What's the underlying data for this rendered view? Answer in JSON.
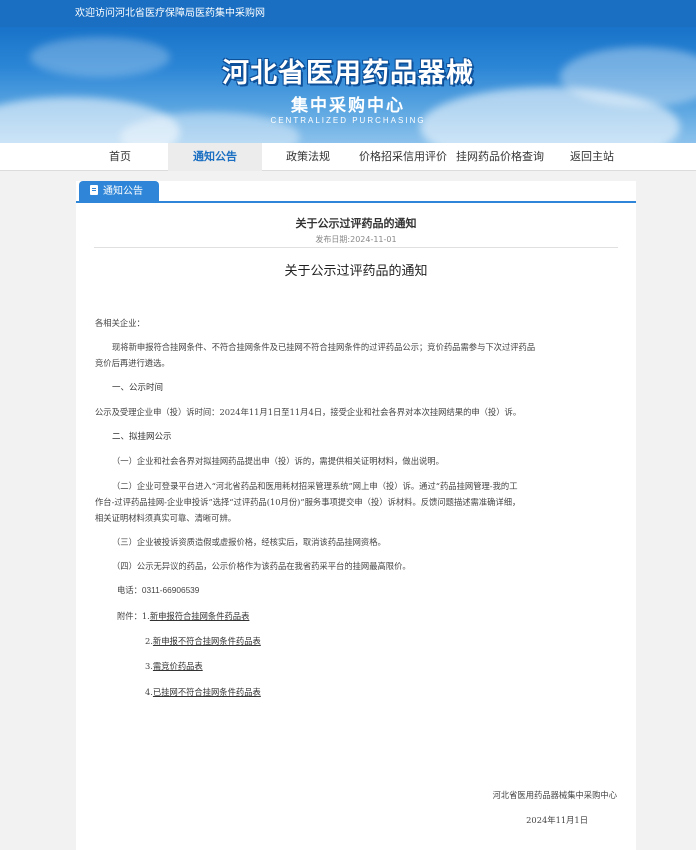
{
  "topbar": {
    "welcome": "欢迎访问河北省医疗保障局医药集中采购网"
  },
  "banner": {
    "title": "河北省医用药品器械",
    "subtitle": "集中采购中心",
    "english": "CENTRALIZED PURCHASING"
  },
  "nav": {
    "items": [
      "首页",
      "通知公告",
      "政策法规",
      "价格招采信用评价",
      "挂网药品价格查询",
      "返回主站"
    ],
    "active": "通知公告"
  },
  "section": {
    "tab_label": "通知公告"
  },
  "article": {
    "title": "关于公示过评药品的通知",
    "date": "发布日期:2024-11-01",
    "heading": "关于公示过评药品的通知",
    "greeting": "各相关企业：",
    "intro_1": "现将新申报符合挂网条件、不符合挂网条件及已挂网不符合挂网条件的过评药品公示；竞价药品需参与下次过评药品",
    "intro_2": "竞价后再进行遴选。",
    "sec1_heading": "一、公示时间",
    "sec1_text": "公示及受理企业申（投）诉时间：2024年11月1日至11月4日，接受企业和社会各界对本次挂网结果的申（投）诉。",
    "sec2_heading": "二、拟挂网公示",
    "item1": "（一）企业和社会各界对拟挂网药品提出申（投）诉的，需提供相关证明材料，做出说明。",
    "item2_1": "（二）企业可登录平台进入“河北省药品和医用耗材招采管理系统”网上申（投）诉。通过“药品挂网管理-我的工",
    "item2_2": "作台-过评药品挂网-企业申投诉”选择“过评药品(10月份)”服务事项提交申（投）诉材料。反馈问题描述需准确详细，",
    "item2_3": "相关证明材料须真实可靠、清晰可辨。",
    "item3": "（三）企业被投诉资质造假或虚报价格，经核实后，取消该药品挂网资格。",
    "item4": "（四）公示无异议的药品，公示价格作为该药品在我省药采平台的挂网最高限价。",
    "phone": "电话：0311-66906539",
    "attach_label": "附件：",
    "attachments": [
      {
        "num": "1.",
        "name": "新申报符合挂网条件药品表"
      },
      {
        "num": "2.",
        "name": "新申报不符合挂网条件药品表"
      },
      {
        "num": "3.",
        "name": "需竞价药品表"
      },
      {
        "num": "4.",
        "name": "已挂网不符合挂网条件药品表"
      }
    ],
    "sign_org": "河北省医用药品器械集中采购中心",
    "sign_date": "2024年11月1日"
  },
  "colors": {
    "primary": "#1a6fc2",
    "tab": "#2f86d8",
    "nav_active_bg": "#ececec"
  }
}
